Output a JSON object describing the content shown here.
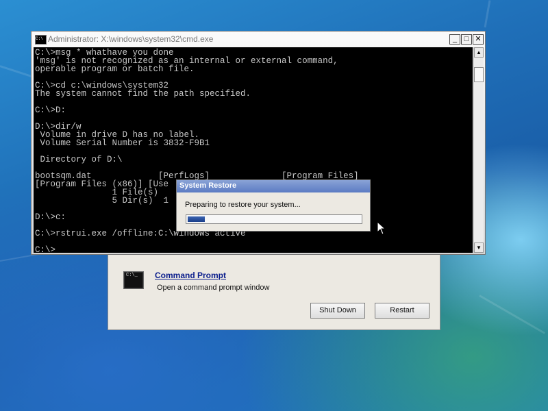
{
  "recovery_window": {
    "command_prompt_link": "Command Prompt",
    "command_prompt_desc": "Open a command prompt window",
    "shutdown_label": "Shut Down",
    "restart_label": "Restart",
    "icon_text": "C:\\_"
  },
  "cmd_window": {
    "title": "Administrator: X:\\windows\\system32\\cmd.exe",
    "icon_text": "C:\\",
    "minimize": "_",
    "maximize": "□",
    "close": "✕",
    "lines": [
      "C:\\>msg * whathave you done",
      "'msg' is not recognized as an internal or external command,",
      "operable program or batch file.",
      "",
      "C:\\>cd c:\\windows\\system32",
      "The system cannot find the path specified.",
      "",
      "C:\\>D:",
      "",
      "D:\\>dir/w",
      " Volume in drive D has no label.",
      " Volume Serial Number is 3832-F9B1",
      "",
      " Directory of D:\\",
      "",
      "bootsqm.dat             [PerfLogs]              [Program Files]",
      "[Program Files (x86)] [Use",
      "               1 File(s)",
      "               5 Dir(s)  1",
      "",
      "D:\\>c:",
      "",
      "C:\\>rstrui.exe /offline:C:\\windows active",
      "",
      "C:\\>"
    ]
  },
  "restore_dialog": {
    "title": "System Restore",
    "message": "Preparing to restore your system...",
    "progress_fraction": 0.1
  },
  "icons": {
    "scroll_up": "▲",
    "scroll_down": "▼"
  },
  "colors": {
    "console_bg": "#000000",
    "console_fg": "#c8c8c8",
    "progress_fill": "#1a3f8a"
  }
}
